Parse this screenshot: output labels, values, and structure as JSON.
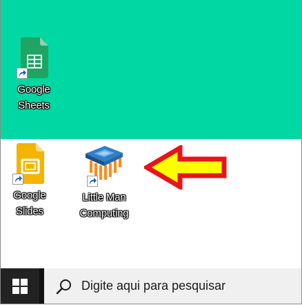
{
  "desktop": {
    "top_background": "#00d7a2",
    "bottom_background": "#ffffff",
    "icons": [
      {
        "name": "google-sheets",
        "label_line1": "Google",
        "label_line2": "Sheets",
        "icon": "google-sheets-icon"
      },
      {
        "name": "google-slides",
        "label_line1": "Google",
        "label_line2": "Slides",
        "icon": "google-slides-icon"
      },
      {
        "name": "little-man-computing",
        "label_line1": "Little Man",
        "label_line2": "Computing",
        "icon": "microchip-icon"
      }
    ],
    "annotation": {
      "icon": "left-arrow-icon",
      "fill": "#ffff00",
      "stroke": "#e8141c"
    }
  },
  "taskbar": {
    "background": "#111111",
    "start_icon": "windows-logo-icon",
    "search": {
      "icon": "search-icon",
      "placeholder": "Digite aqui para pesquisar",
      "background": "#f0f0f0"
    }
  }
}
